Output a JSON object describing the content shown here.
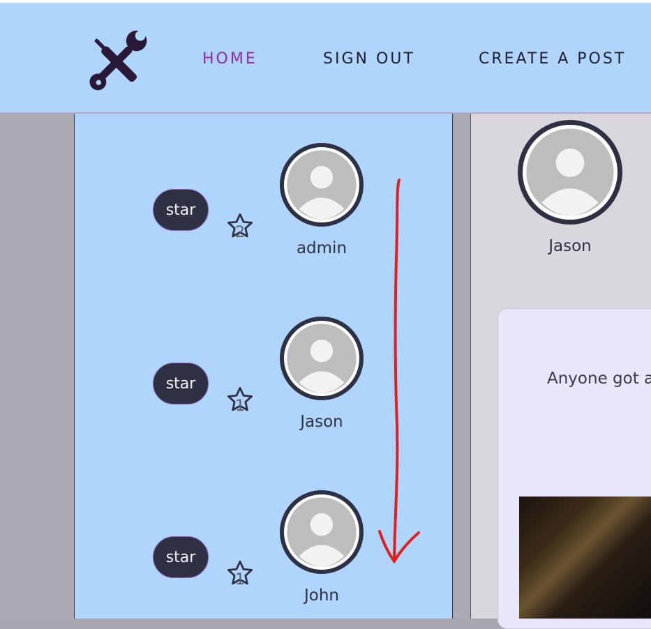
{
  "nav": {
    "logo": "tools-icon",
    "items": [
      {
        "label": "HOME",
        "active": true
      },
      {
        "label": "SIGN OUT",
        "active": false
      },
      {
        "label": "CREATE A POST",
        "active": false
      }
    ]
  },
  "users": [
    {
      "button": "star",
      "stars": "2",
      "name": "admin"
    },
    {
      "button": "star",
      "stars": "1",
      "name": "Jason"
    },
    {
      "button": "star",
      "stars": "1",
      "name": "John"
    }
  ],
  "post": {
    "author": "Jason",
    "text": "Anyone got a"
  },
  "colors": {
    "header": "#afd5fd",
    "active_nav": "#8e2fa8",
    "button_bg": "#2e3143",
    "annotation_arrow": "#e01f1f"
  }
}
